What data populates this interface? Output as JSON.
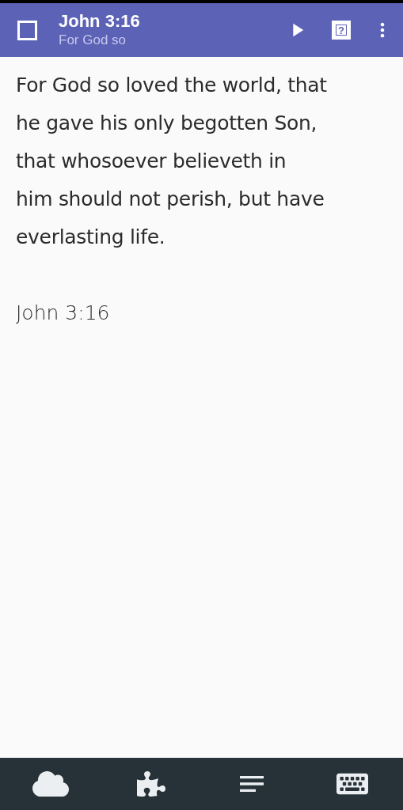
{
  "toolbar": {
    "title": "John 3:16",
    "subtitle": "For God so",
    "help_glyph": "?"
  },
  "verse": {
    "lines": [
      "For God so loved the world, that",
      "he gave his only begotten Son,",
      "that whosoever believeth in",
      "him should not perish, but have",
      "everlasting life."
    ],
    "reference": "John 3:16"
  }
}
